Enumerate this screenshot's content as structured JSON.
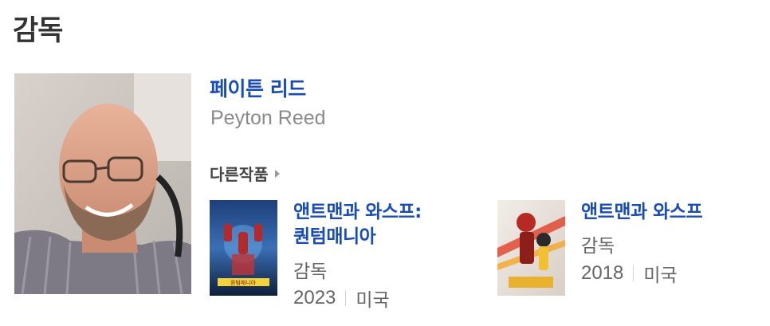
{
  "section": {
    "title": "감독"
  },
  "person": {
    "name_ko": "페이튼 리드",
    "name_en": "Peyton Reed"
  },
  "other_works_label": "다른작품",
  "works": [
    {
      "title_line1": "앤트맨과 와스프:",
      "title_line2": "퀀텀매니아",
      "role": "감독",
      "year": "2023",
      "country": "미국",
      "poster_text": "퀀텀매니아"
    },
    {
      "title_line1": "앤트맨과 와스프",
      "role": "감독",
      "year": "2018",
      "country": "미국"
    }
  ],
  "colors": {
    "link_blue": "#1a4db3",
    "heading": "#333333",
    "muted": "#8a8a8a"
  }
}
